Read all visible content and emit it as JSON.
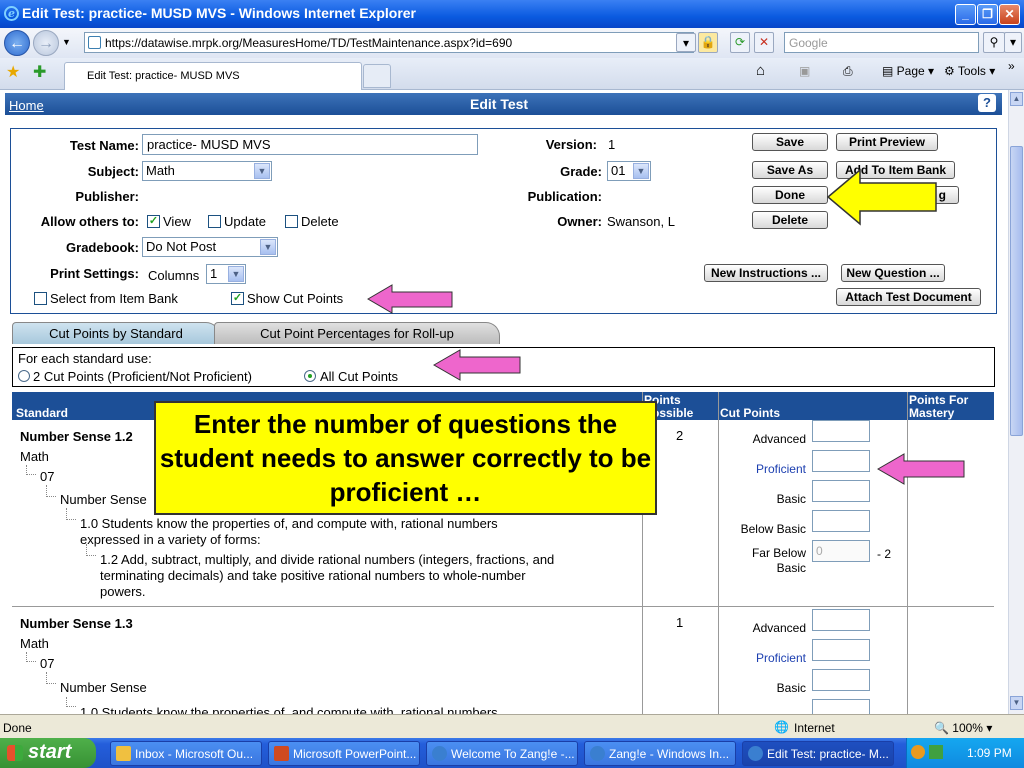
{
  "window": {
    "title": "Edit Test: practice- MUSD MVS - Windows Internet Explorer"
  },
  "browser": {
    "url": "https://datawise.mrpk.org/MeasuresHome/TD/TestMaintenance.aspx?id=690",
    "search_placeholder": "Google",
    "tab_title": "Edit Test: practice- MUSD MVS",
    "page_menu": "Page",
    "tools_menu": "Tools"
  },
  "header": {
    "home": "Home",
    "title": "Edit Test",
    "help": "?"
  },
  "form": {
    "test_name_label": "Test Name:",
    "test_name": "practice- MUSD MVS",
    "subject_label": "Subject:",
    "subject": "Math",
    "publisher_label": "Publisher:",
    "allow_label": "Allow others to:",
    "view": "View",
    "update": "Update",
    "delete": "Delete",
    "gradebook_label": "Gradebook:",
    "gradebook": "Do Not Post",
    "print_label": "Print Settings:",
    "columns_label": "Columns",
    "columns": "1",
    "select_item_bank": "Select from Item Bank",
    "show_cut_points": "Show Cut Points",
    "version_label": "Version:",
    "version": "1",
    "grade_label": "Grade:",
    "grade": "01",
    "publication_label": "Publication:",
    "owner_label": "Owner:",
    "owner": "Swanson, L"
  },
  "buttons": {
    "save": "Save",
    "print_preview": "Print Preview",
    "save_as": "Save As",
    "add_to_item_bank": "Add To Item Bank",
    "done": "Done",
    "hidden_partial": "g",
    "delete": "Delete",
    "new_instructions": "New Instructions ...",
    "new_question": "New Question ...",
    "attach_doc": "Attach Test Document"
  },
  "tabs": {
    "cut_points_by_standard": "Cut Points by Standard",
    "cut_point_percentages": "Cut Point Percentages for Roll-up"
  },
  "standard_use": {
    "label": "For each standard use:",
    "option_two": "2 Cut Points (Proficient/Not Proficient)",
    "option_all": "All Cut Points"
  },
  "table": {
    "col_standard": "Standard",
    "col_points_line1": "Points",
    "col_points_line2": "Possible",
    "col_cut_points": "Cut Points",
    "col_mastery_line1": "Points For",
    "col_mastery_line2": "Mastery",
    "rows": [
      {
        "title": "Number Sense 1.2",
        "subject": "Math",
        "grade": "07",
        "strand": "Number Sense",
        "std": "1.0 Students know the properties of, and compute with, rational numbers",
        "std2": "expressed in a variety of forms:",
        "sub": "1.2 Add, subtract, multiply, and divide rational numbers (integers, fractions, and",
        "sub2": "terminating decimals) and take positive rational numbers to whole-number",
        "sub3": "powers.",
        "points": "2",
        "far_below_value": "0",
        "far_below_suffix": "- 2"
      },
      {
        "title": "Number Sense 1.3",
        "subject": "Math",
        "grade": "07",
        "strand": "Number Sense",
        "std": "1.0 Students know the properties of, and compute with, rational numbers",
        "points": "1"
      }
    ],
    "levels": {
      "advanced": "Advanced",
      "proficient": "Proficient",
      "basic": "Basic",
      "below_basic": "Below Basic",
      "far_below_1": "Far Below",
      "far_below_2": "Basic"
    }
  },
  "callout": {
    "text": "Enter the number of questions the student needs to answer correctly to be proficient …"
  },
  "colors": {
    "accent": "#1c4f97",
    "callout": "#ffff00",
    "arrow_yellow": "#ffff00",
    "arrow_pink": "#ee66cc",
    "proficient": "#1c3fb0"
  },
  "status": {
    "left": "Done",
    "zone": "Internet",
    "zoom": "100%"
  },
  "taskbar": {
    "start": "start",
    "items": [
      "Inbox - Microsoft Ou...",
      "Microsoft PowerPoint...",
      "Welcome To Zang!e -...",
      "Zang!e - Windows In...",
      "Edit Test: practice- M..."
    ],
    "time": "1:09 PM"
  }
}
